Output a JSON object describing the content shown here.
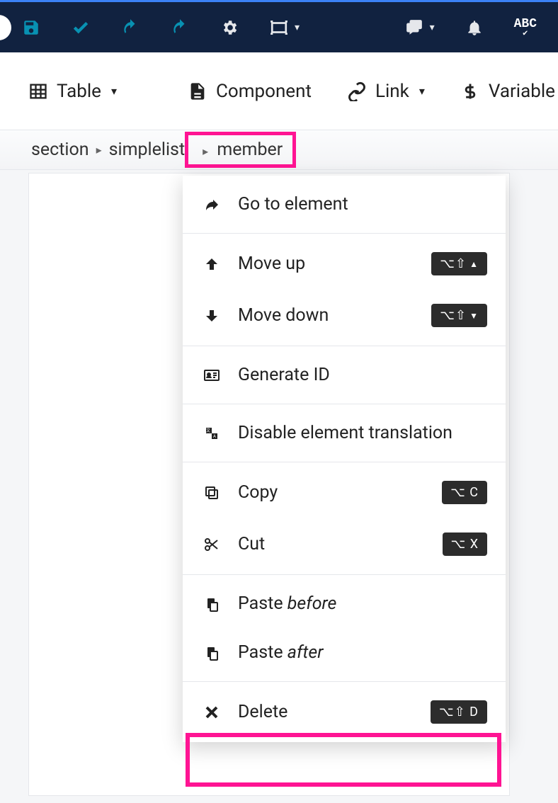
{
  "topToolbar": {
    "save": "save",
    "approve": "approve",
    "undo": "undo",
    "redo": "redo",
    "settings": "settings",
    "frame": "frame",
    "comments": "comments",
    "notifications": "notifications",
    "spellcheck_label": "ABC"
  },
  "secondaryToolbar": {
    "table": "Table",
    "component": "Component",
    "link": "Link",
    "variable": "Variable"
  },
  "breadcrumb": {
    "items": [
      "section",
      "simplelist",
      "member"
    ]
  },
  "contextMenu": {
    "goToElement": "Go to element",
    "moveUp": "Move up",
    "moveDown": "Move down",
    "generateId": "Generate ID",
    "disableTranslation": "Disable element translation",
    "copy": "Copy",
    "cut": "Cut",
    "pasteBeforePrefix": "Paste ",
    "pasteBeforeEm": "before",
    "pasteAfterPrefix": "Paste ",
    "pasteAfterEm": "after",
    "delete": "Delete",
    "shortcuts": {
      "moveUp": "⌥⇧ ▲",
      "moveDown": "⌥⇧ ▼",
      "copy": "⌥ C",
      "cut": "⌥ X",
      "delete": "⌥⇧ D"
    }
  }
}
